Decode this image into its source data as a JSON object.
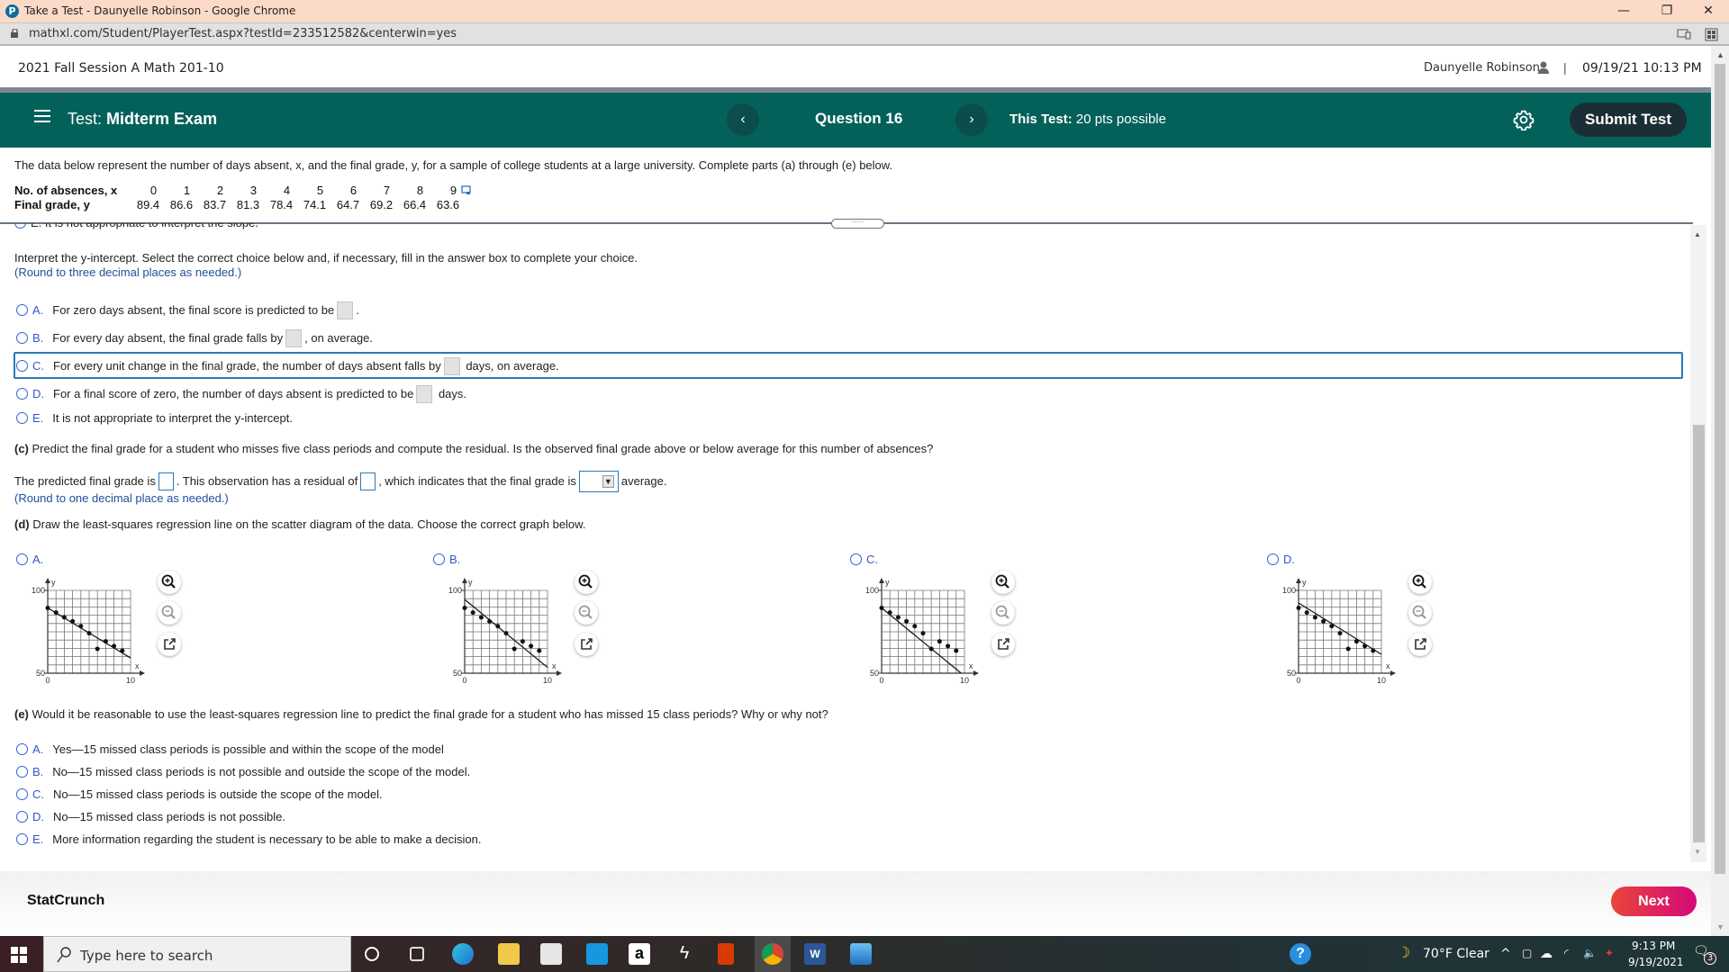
{
  "browser": {
    "window_title": "Take a Test - Daunyelle Robinson - Google Chrome",
    "url": "mathxl.com/Student/PlayerTest.aspx?testId=233512582&centerwin=yes",
    "min_icon": "—",
    "restore_icon": "❐",
    "close_icon": "✕"
  },
  "course": {
    "name": "2021 Fall Session A Math 201-10",
    "user": "Daunyelle Robinson",
    "separator": "|",
    "datetime": "09/19/21 10:13 PM"
  },
  "nav": {
    "test_prefix": "Test:",
    "test_name": "Midterm Exam",
    "prev": "‹",
    "question": "Question 16",
    "next": "›",
    "points_label": "This Test:",
    "points_value": "20 pts possible",
    "submit": "Submit Test"
  },
  "question": {
    "intro": "The data below represent the number of days absent, x, and the final grade, y, for a sample of college students at a large university. Complete parts (a) through (e) below.",
    "table": {
      "x_label": "No. of absences, x",
      "y_label": "Final grade, y",
      "x": [
        "0",
        "1",
        "2",
        "3",
        "4",
        "5",
        "6",
        "7",
        "8",
        "9"
      ],
      "y": [
        "89.4",
        "86.6",
        "83.7",
        "81.3",
        "78.4",
        "74.1",
        "64.7",
        "69.2",
        "66.4",
        "63.6"
      ]
    },
    "cutoff_text": "E.   It is not appropriate to interpret the slope.",
    "yint": {
      "prompt": "Interpret the y-intercept. Select the correct choice below and, if necessary, fill in the answer box to complete your choice.",
      "hint": "(Round to three decimal places as needed.)",
      "options": [
        {
          "letter": "A.",
          "before": "For zero days absent, the final score is predicted to be",
          "after": "."
        },
        {
          "letter": "B.",
          "before": "For every day absent, the final grade falls by",
          "after": ", on average."
        },
        {
          "letter": "C.",
          "before": "For every unit change in the final grade, the number of days absent falls by",
          "after": " days, on average."
        },
        {
          "letter": "D.",
          "before": "For a final score of zero, the number of days absent is predicted to be",
          "after": " days."
        },
        {
          "letter": "E.",
          "before": "It is not appropriate to interpret the y-intercept.",
          "after": ""
        }
      ]
    },
    "part_c": {
      "prompt_bold": "(c)",
      "prompt": " Predict the final grade for a student who misses five class periods and compute the residual. Is the observed final grade above or below average for this number of absences?",
      "s1": "The predicted final grade is",
      "s2": ". This observation has a residual of",
      "s3": ", which indicates that the final grade is",
      "s4": "average.",
      "dropdown_value": "",
      "hint": "(Round to one decimal place as needed.)"
    },
    "part_d": {
      "prompt_bold": "(d)",
      "prompt": " Draw the least-squares regression line on the scatter diagram of the data. Choose the correct graph below.",
      "options": [
        "A.",
        "B.",
        "C.",
        "D."
      ]
    },
    "part_e": {
      "prompt_bold": "(e)",
      "prompt": " Would it be reasonable to use the least-squares regression line to predict the final grade for a student who has missed 15 class periods? Why or why not?",
      "options": [
        {
          "letter": "A.",
          "text": "Yes—15 missed class periods is possible and within the scope of the model"
        },
        {
          "letter": "B.",
          "text": "No—15 missed class periods is not possible and outside the scope of the model."
        },
        {
          "letter": "C.",
          "text": "No—15 missed class periods is outside the scope of the model."
        },
        {
          "letter": "D.",
          "text": "No—15 missed class periods is not possible."
        },
        {
          "letter": "E.",
          "text": "More information regarding the student is necessary to be able to make a decision."
        }
      ]
    }
  },
  "chart_data": [
    {
      "type": "scatter",
      "option": "A",
      "x": [
        0,
        1,
        2,
        3,
        4,
        5,
        6,
        7,
        8,
        9
      ],
      "y": [
        89.4,
        86.6,
        83.7,
        81.3,
        78.4,
        74.1,
        64.7,
        69.2,
        66.4,
        63.6
      ],
      "line": {
        "x": [
          0,
          10
        ],
        "y": [
          89.4,
          59.2
        ]
      },
      "xlabel": "x",
      "ylabel": "y",
      "xlim": [
        0,
        10
      ],
      "ylim": [
        50,
        100
      ],
      "x_ticks": [
        "0",
        "10"
      ],
      "y_ticks": [
        "50",
        "100"
      ],
      "grid": true
    },
    {
      "type": "scatter",
      "option": "B",
      "x": [
        0,
        1,
        2,
        3,
        4,
        5,
        6,
        7,
        8,
        9
      ],
      "y": [
        89.4,
        86.6,
        83.7,
        81.3,
        78.4,
        74.1,
        64.7,
        69.2,
        66.4,
        63.6
      ],
      "line": {
        "x": [
          0,
          10
        ],
        "y": [
          94.5,
          53.5
        ]
      },
      "xlabel": "x",
      "ylabel": "y",
      "xlim": [
        0,
        10
      ],
      "ylim": [
        50,
        100
      ],
      "x_ticks": [
        "0",
        "10"
      ],
      "y_ticks": [
        "50",
        "100"
      ],
      "grid": true
    },
    {
      "type": "scatter",
      "option": "C",
      "x": [
        0,
        1,
        2,
        3,
        4,
        5,
        6,
        7,
        8,
        9
      ],
      "y": [
        89.4,
        86.6,
        83.7,
        81.3,
        78.4,
        74.1,
        64.7,
        69.2,
        66.4,
        63.6
      ],
      "line": {
        "x": [
          0,
          9.6
        ],
        "y": [
          89.4,
          50
        ]
      },
      "xlabel": "x",
      "ylabel": "y",
      "xlim": [
        0,
        10
      ],
      "ylim": [
        50,
        100
      ],
      "x_ticks": [
        "0",
        "10"
      ],
      "y_ticks": [
        "50",
        "100"
      ],
      "grid": true
    },
    {
      "type": "scatter",
      "option": "D",
      "x": [
        0,
        1,
        2,
        3,
        4,
        5,
        6,
        7,
        8,
        9
      ],
      "y": [
        89.4,
        86.6,
        83.7,
        81.3,
        78.4,
        74.1,
        64.7,
        69.2,
        66.4,
        63.6
      ],
      "line": {
        "x": [
          0,
          10
        ],
        "y": [
          92.4,
          61.4
        ]
      },
      "xlabel": "x",
      "ylabel": "y",
      "xlim": [
        0,
        10
      ],
      "ylim": [
        50,
        100
      ],
      "x_ticks": [
        "0",
        "10"
      ],
      "y_ticks": [
        "50",
        "100"
      ],
      "grid": true
    }
  ],
  "footer": {
    "statcrunch": "StatCrunch",
    "next": "Next"
  },
  "taskbar": {
    "search_placeholder": "Type here to search",
    "weather": "70°F  Clear",
    "time": "9:13 PM",
    "date": "9/19/2021",
    "notifications": "3"
  }
}
